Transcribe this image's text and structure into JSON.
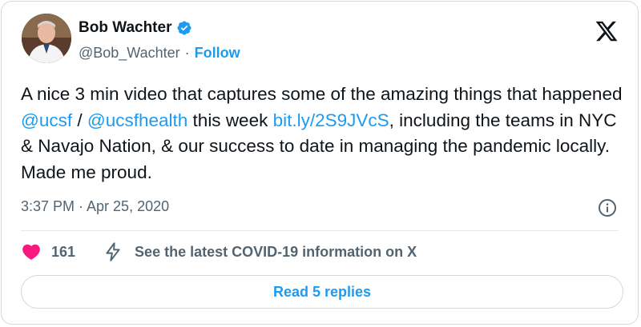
{
  "author": {
    "name": "Bob Wachter",
    "handle": "@Bob_Wachter",
    "separator": "·",
    "follow_label": "Follow"
  },
  "tweet": {
    "part1": "A nice 3 min video that captures some of the amazing things that happened ",
    "mention1": "@ucsf",
    "part2": " / ",
    "mention2": "@ucsfhealth",
    "part3": " this week ",
    "link": "bit.ly/2S9JVcS",
    "part4": ", including the teams in NYC & Navajo Nation, & our success to date in managing the pandemic locally. Made me proud."
  },
  "meta": {
    "timestamp": "3:37 PM · Apr 25, 2020"
  },
  "actions": {
    "likes": "161",
    "covid_info": "See the latest COVID-19 information on X"
  },
  "replies_button": "Read 5 replies",
  "colors": {
    "accent": "#1d9bf0",
    "heart": "#f91880",
    "text": "#0f1419",
    "muted": "#536471"
  },
  "icons": [
    "verified-badge-icon",
    "x-logo-icon",
    "info-icon",
    "heart-icon",
    "lightning-bolt-icon"
  ]
}
